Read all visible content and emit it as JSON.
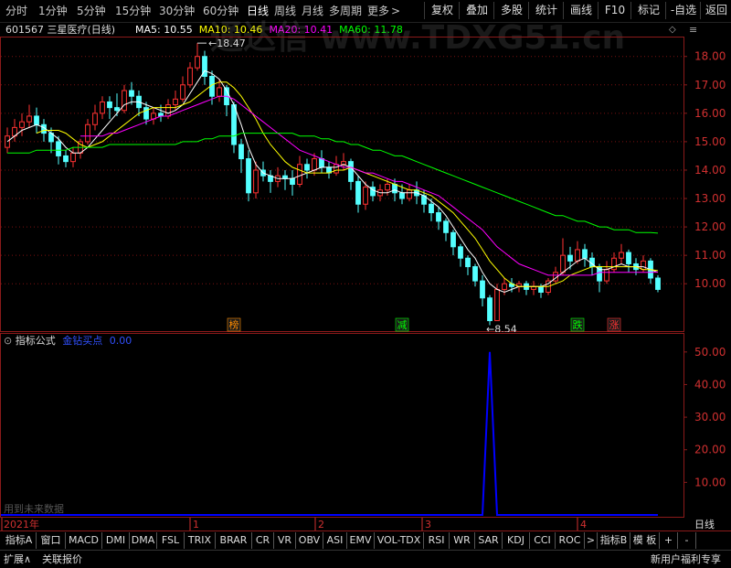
{
  "toolbar": {
    "periods": [
      "分时",
      "1分钟",
      "5分钟",
      "15分钟",
      "30分钟",
      "60分钟",
      "日线",
      "周线",
      "月线",
      "多周期",
      "更多"
    ],
    "active_period": "日线",
    "more_arrow": ">",
    "buttons": [
      "复权",
      "叠加",
      "多股",
      "统计",
      "画线",
      "F10",
      "标记",
      "-自选",
      "返回"
    ]
  },
  "stock": {
    "code": "601567",
    "name": "三星医疗",
    "period": "(日线)"
  },
  "ma": [
    {
      "label": "MA5: 10.55",
      "color": "#ffffff"
    },
    {
      "label": "MA10: 10.46",
      "color": "#ffff00"
    },
    {
      "label": "MA20: 10.41",
      "color": "#ff00ff"
    },
    {
      "label": "MA60: 11.78",
      "color": "#00ff00"
    }
  ],
  "watermark": "通达信 www.TDXG51.cn",
  "price_axis": [
    "18.00",
    "17.00",
    "16.00",
    "15.00",
    "14.00",
    "13.00",
    "12.00",
    "11.00",
    "10.00"
  ],
  "price_axis_values": [
    18,
    17,
    16,
    15,
    14,
    13,
    12,
    11,
    10
  ],
  "annotations": {
    "high": "18.47",
    "low": "8.54"
  },
  "markers": [
    {
      "text": "榜",
      "color": "#ff8c00"
    },
    {
      "text": "减",
      "color": "#00ff00"
    },
    {
      "text": "跌",
      "color": "#00ff00"
    },
    {
      "text": "涨",
      "color": "#ff3333"
    }
  ],
  "indicator": {
    "title": "指标公式",
    "name": "金钻买点",
    "value": "0.00",
    "axis": [
      "50.00",
      "40.00",
      "30.00",
      "20.00",
      "10.00"
    ],
    "axis_values": [
      50,
      40,
      30,
      20,
      10
    ],
    "note": "用到未来数据"
  },
  "time_axis": {
    "year": "2021年",
    "months": [
      "1",
      "2",
      "3",
      "4"
    ],
    "right_label": "日线"
  },
  "tabs": [
    "指标A",
    "窗口",
    "MACD",
    "DMI",
    "DMA",
    "FSL",
    "TRIX",
    "BRAR",
    "CR",
    "VR",
    "OBV",
    "ASI",
    "EMV",
    "VOL-TDX",
    "RSI",
    "WR",
    "SAR",
    "KDJ",
    "CCI",
    "ROC",
    ">",
    "指标B",
    "模 板",
    "+",
    "-"
  ],
  "bottom": {
    "expand": "扩展∧",
    "related": "关联报价",
    "promo": "新用户福利专享"
  },
  "chart_data": {
    "type": "candlestick",
    "ylim": [
      8.3,
      18.7
    ],
    "candles": [
      [
        14.8,
        15.2,
        15.5,
        14.6
      ],
      [
        15.2,
        15.5,
        15.8,
        15.0
      ],
      [
        15.5,
        15.7,
        16.0,
        15.2
      ],
      [
        15.7,
        15.9,
        16.3,
        15.5
      ],
      [
        15.9,
        15.6,
        16.2,
        15.3
      ],
      [
        15.6,
        15.3,
        15.8,
        15.0
      ],
      [
        15.3,
        15.0,
        15.5,
        14.6
      ],
      [
        15.0,
        14.5,
        15.2,
        14.2
      ],
      [
        14.5,
        14.3,
        14.7,
        14.1
      ],
      [
        14.3,
        14.6,
        14.8,
        14.1
      ],
      [
        14.6,
        15.0,
        15.1,
        14.4
      ],
      [
        15.0,
        15.6,
        15.8,
        14.9
      ],
      [
        15.6,
        16.0,
        16.3,
        15.4
      ],
      [
        16.0,
        16.4,
        16.6,
        15.8
      ],
      [
        16.4,
        16.2,
        16.6,
        15.8
      ],
      [
        16.2,
        16.1,
        16.7,
        15.9
      ],
      [
        16.1,
        16.8,
        17.0,
        16.0
      ],
      [
        16.8,
        16.6,
        17.1,
        16.3
      ],
      [
        16.6,
        16.2,
        16.8,
        15.9
      ],
      [
        16.2,
        15.8,
        16.4,
        15.6
      ],
      [
        15.8,
        16.0,
        16.2,
        15.6
      ],
      [
        16.0,
        15.9,
        16.3,
        15.7
      ],
      [
        15.9,
        16.3,
        16.5,
        15.8
      ],
      [
        16.3,
        16.5,
        16.8,
        16.1
      ],
      [
        16.5,
        17.0,
        17.3,
        16.4
      ],
      [
        17.0,
        17.6,
        17.8,
        16.9
      ],
      [
        17.6,
        18.0,
        18.47,
        17.5
      ],
      [
        18.0,
        17.3,
        18.2,
        17.0
      ],
      [
        17.3,
        16.6,
        17.5,
        16.3
      ],
      [
        16.6,
        16.9,
        17.2,
        16.4
      ],
      [
        16.9,
        16.3,
        17.0,
        15.9
      ],
      [
        16.3,
        14.9,
        16.4,
        14.6
      ],
      [
        14.9,
        14.4,
        15.1,
        13.9
      ],
      [
        14.4,
        13.2,
        14.7,
        12.9
      ],
      [
        13.2,
        14.0,
        14.3,
        13.0
      ],
      [
        14.0,
        13.8,
        14.3,
        13.6
      ],
      [
        13.8,
        13.6,
        14.0,
        13.2
      ],
      [
        13.6,
        13.8,
        14.1,
        13.4
      ],
      [
        13.8,
        13.7,
        14.0,
        13.3
      ],
      [
        13.7,
        13.5,
        14.0,
        13.1
      ],
      [
        13.5,
        14.2,
        14.5,
        13.4
      ],
      [
        14.2,
        14.0,
        14.4,
        13.7
      ],
      [
        14.0,
        14.4,
        14.6,
        13.8
      ],
      [
        14.4,
        14.1,
        14.7,
        13.9
      ],
      [
        14.1,
        13.9,
        14.3,
        13.7
      ],
      [
        13.9,
        14.2,
        14.5,
        13.8
      ],
      [
        14.2,
        14.3,
        14.6,
        14.0
      ],
      [
        14.3,
        13.6,
        14.4,
        13.3
      ],
      [
        13.6,
        12.8,
        13.8,
        12.5
      ],
      [
        12.8,
        13.4,
        13.6,
        12.6
      ],
      [
        13.4,
        13.1,
        13.6,
        12.9
      ],
      [
        13.1,
        13.3,
        13.5,
        12.9
      ],
      [
        13.3,
        13.5,
        13.7,
        13.1
      ],
      [
        13.5,
        13.2,
        13.7,
        12.9
      ],
      [
        13.2,
        13.0,
        13.5,
        12.8
      ],
      [
        13.0,
        13.3,
        13.5,
        12.9
      ],
      [
        13.3,
        13.1,
        13.6,
        12.8
      ],
      [
        13.1,
        12.8,
        13.3,
        12.5
      ],
      [
        12.8,
        12.5,
        13.0,
        12.2
      ],
      [
        12.5,
        12.2,
        12.7,
        11.9
      ],
      [
        12.2,
        11.8,
        12.3,
        11.5
      ],
      [
        11.8,
        11.3,
        11.9,
        11.0
      ],
      [
        11.3,
        10.9,
        11.4,
        10.6
      ],
      [
        10.9,
        10.6,
        11.0,
        10.3
      ],
      [
        10.6,
        10.1,
        10.7,
        9.9
      ],
      [
        10.1,
        9.5,
        10.3,
        9.2
      ],
      [
        9.5,
        8.7,
        9.6,
        8.54
      ],
      [
        8.7,
        9.8,
        10.0,
        8.7
      ],
      [
        9.8,
        10.0,
        10.2,
        9.6
      ],
      [
        10.0,
        9.9,
        10.2,
        9.7
      ],
      [
        9.9,
        10.0,
        10.1,
        9.7
      ],
      [
        10.0,
        9.8,
        10.1,
        9.6
      ],
      [
        9.8,
        9.9,
        10.1,
        9.6
      ],
      [
        9.9,
        9.7,
        10.0,
        9.5
      ],
      [
        9.7,
        10.1,
        10.2,
        9.6
      ],
      [
        10.1,
        10.4,
        10.6,
        10.0
      ],
      [
        10.4,
        11.0,
        11.6,
        10.3
      ],
      [
        11.0,
        10.8,
        11.3,
        10.5
      ],
      [
        10.8,
        11.2,
        11.5,
        10.7
      ],
      [
        11.2,
        10.9,
        11.4,
        10.6
      ],
      [
        10.9,
        10.6,
        11.1,
        10.3
      ],
      [
        10.6,
        10.1,
        10.7,
        9.7
      ],
      [
        10.1,
        10.5,
        10.8,
        10.0
      ],
      [
        10.5,
        10.9,
        11.1,
        10.4
      ],
      [
        10.9,
        11.1,
        11.4,
        10.7
      ],
      [
        11.1,
        10.7,
        11.2,
        10.4
      ],
      [
        10.7,
        10.5,
        10.9,
        10.3
      ],
      [
        10.5,
        10.8,
        11.0,
        10.4
      ],
      [
        10.8,
        10.2,
        10.9,
        10.0
      ],
      [
        10.2,
        9.8,
        10.3,
        9.7
      ]
    ],
    "ma_lines": [
      {
        "name": "MA5",
        "color": "#ffffff",
        "values": [
          15.0,
          15.2,
          15.4,
          15.5,
          15.6,
          15.5,
          15.3,
          15.1,
          14.8,
          14.6,
          14.6,
          14.8,
          15.1,
          15.4,
          15.7,
          16.0,
          16.3,
          16.4,
          16.4,
          16.3,
          16.2,
          16.1,
          16.0,
          16.1,
          16.3,
          16.7,
          17.1,
          17.5,
          17.4,
          17.2,
          16.8,
          16.3,
          15.6,
          14.8,
          14.2,
          13.9,
          13.8,
          13.7,
          13.7,
          13.7,
          13.8,
          13.9,
          14.0,
          14.1,
          14.1,
          14.1,
          14.2,
          14.1,
          13.8,
          13.5,
          13.3,
          13.2,
          13.2,
          13.3,
          13.2,
          13.2,
          13.2,
          13.1,
          12.9,
          12.7,
          12.4,
          12.0,
          11.6,
          11.2,
          10.9,
          10.4,
          10.0,
          9.8,
          9.7,
          9.8,
          9.9,
          9.9,
          9.9,
          9.9,
          10.0,
          10.2,
          10.4,
          10.6,
          10.8,
          10.9,
          10.7,
          10.5,
          10.5,
          10.6,
          10.7,
          10.6,
          10.6,
          10.6,
          10.5,
          10.4
        ]
      },
      {
        "name": "MA10",
        "color": "#ffff00",
        "values": [
          null,
          null,
          null,
          null,
          15.3,
          15.4,
          15.4,
          15.4,
          15.3,
          15.1,
          14.9,
          14.8,
          14.9,
          15.0,
          15.2,
          15.4,
          15.6,
          15.8,
          16.0,
          16.1,
          16.2,
          16.2,
          16.2,
          16.2,
          16.3,
          16.4,
          16.6,
          16.8,
          17.0,
          17.1,
          17.1,
          16.9,
          16.6,
          16.2,
          15.8,
          15.3,
          14.9,
          14.6,
          14.3,
          14.1,
          14.0,
          13.9,
          13.9,
          13.9,
          13.9,
          14.0,
          14.0,
          14.1,
          14.0,
          13.9,
          13.8,
          13.7,
          13.6,
          13.5,
          13.4,
          13.3,
          13.3,
          13.2,
          13.1,
          12.9,
          12.7,
          12.5,
          12.2,
          11.9,
          11.6,
          11.2,
          10.8,
          10.5,
          10.2,
          10.0,
          9.9,
          9.9,
          9.9,
          9.9,
          9.9,
          10.0,
          10.1,
          10.3,
          10.4,
          10.5,
          10.6,
          10.6,
          10.6,
          10.6,
          10.6,
          10.6,
          10.6,
          10.5,
          10.5,
          10.46
        ]
      },
      {
        "name": "MA20",
        "color": "#ff00ff",
        "values": [
          null,
          null,
          null,
          null,
          null,
          null,
          null,
          null,
          null,
          null,
          15.2,
          15.2,
          15.2,
          15.2,
          15.3,
          15.3,
          15.4,
          15.5,
          15.6,
          15.7,
          15.8,
          15.9,
          15.9,
          16.0,
          16.1,
          16.2,
          16.3,
          16.4,
          16.5,
          16.6,
          16.6,
          16.5,
          16.3,
          16.1,
          15.9,
          15.7,
          15.5,
          15.3,
          15.1,
          14.9,
          14.7,
          14.6,
          14.5,
          14.4,
          14.3,
          14.2,
          14.1,
          14.1,
          14.0,
          13.9,
          13.9,
          13.8,
          13.7,
          13.6,
          13.6,
          13.5,
          13.4,
          13.3,
          13.2,
          13.1,
          12.9,
          12.7,
          12.5,
          12.3,
          12.1,
          11.9,
          11.6,
          11.3,
          11.1,
          10.9,
          10.7,
          10.6,
          10.5,
          10.4,
          10.3,
          10.3,
          10.3,
          10.3,
          10.3,
          10.3,
          10.3,
          10.4,
          10.4,
          10.4,
          10.4,
          10.4,
          10.4,
          10.4,
          10.4,
          10.41
        ]
      },
      {
        "name": "MA60",
        "color": "#00ff00",
        "values": [
          14.6,
          14.6,
          14.6,
          14.6,
          14.7,
          14.7,
          14.7,
          14.7,
          14.7,
          14.8,
          14.8,
          14.8,
          14.8,
          14.8,
          14.9,
          14.9,
          14.9,
          14.9,
          14.9,
          14.9,
          14.9,
          14.9,
          14.9,
          14.9,
          15.0,
          15.0,
          15.0,
          15.1,
          15.1,
          15.2,
          15.2,
          15.2,
          15.3,
          15.3,
          15.3,
          15.3,
          15.3,
          15.3,
          15.3,
          15.3,
          15.2,
          15.2,
          15.2,
          15.1,
          15.1,
          15.0,
          15.0,
          14.9,
          14.9,
          14.8,
          14.7,
          14.7,
          14.6,
          14.5,
          14.5,
          14.4,
          14.3,
          14.2,
          14.1,
          14.0,
          13.9,
          13.8,
          13.7,
          13.6,
          13.5,
          13.4,
          13.3,
          13.2,
          13.1,
          13.0,
          12.9,
          12.8,
          12.7,
          12.6,
          12.5,
          12.4,
          12.4,
          12.3,
          12.2,
          12.2,
          12.1,
          12.0,
          12.0,
          11.9,
          11.9,
          11.9,
          11.8,
          11.8,
          11.8,
          11.78
        ]
      }
    ],
    "indicator_series": {
      "name": "金钻买点",
      "color": "#0000ff",
      "ylim": [
        0,
        55
      ],
      "values": [
        0,
        0,
        0,
        0,
        0,
        0,
        0,
        0,
        0,
        0,
        0,
        0,
        0,
        0,
        0,
        0,
        0,
        0,
        0,
        0,
        0,
        0,
        0,
        0,
        0,
        0,
        0,
        0,
        0,
        0,
        0,
        0,
        0,
        0,
        0,
        0,
        0,
        0,
        0,
        0,
        0,
        0,
        0,
        0,
        0,
        0,
        0,
        0,
        0,
        0,
        0,
        0,
        0,
        0,
        0,
        0,
        0,
        0,
        0,
        0,
        0,
        0,
        0,
        0,
        0,
        0,
        50,
        0,
        0,
        0,
        0,
        0,
        0,
        0,
        0,
        0,
        0,
        0,
        0,
        0,
        0,
        0,
        0,
        0,
        0,
        0,
        0,
        0,
        0,
        0
      ]
    }
  }
}
